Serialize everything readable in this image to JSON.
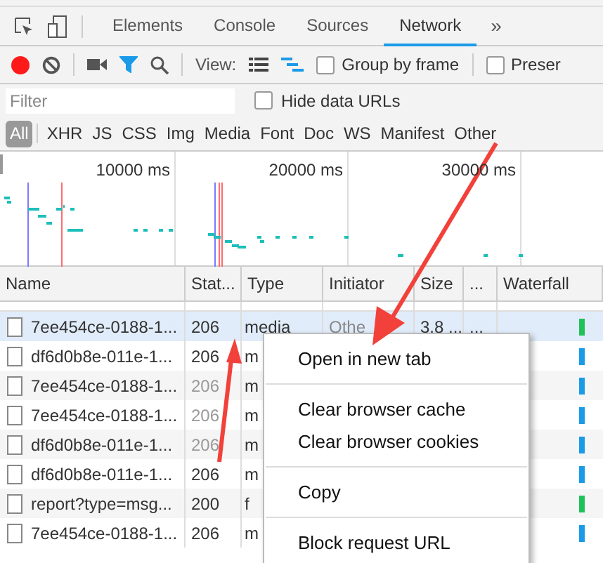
{
  "tabs": [
    {
      "label": "Elements",
      "selected": false
    },
    {
      "label": "Console",
      "selected": false
    },
    {
      "label": "Sources",
      "selected": false
    },
    {
      "label": "Network",
      "selected": true
    }
  ],
  "more_tabs": "»",
  "toolbar": {
    "recording": true,
    "filter_on": true,
    "view_label": "View:",
    "group_by_frame": {
      "label": "Group by frame",
      "checked": false
    },
    "preserve": {
      "label": "Preser",
      "checked": false
    }
  },
  "filter": {
    "placeholder": "Filter",
    "hide_data_urls": {
      "label": "Hide data URLs",
      "checked": false
    }
  },
  "types": [
    {
      "label": "All",
      "selected": true
    },
    {
      "label": "XHR",
      "selected": false
    },
    {
      "label": "JS",
      "selected": false
    },
    {
      "label": "CSS",
      "selected": false
    },
    {
      "label": "Img",
      "selected": false
    },
    {
      "label": "Media",
      "selected": false
    },
    {
      "label": "Font",
      "selected": false
    },
    {
      "label": "Doc",
      "selected": false
    },
    {
      "label": "WS",
      "selected": false
    },
    {
      "label": "Manifest",
      "selected": false
    },
    {
      "label": "Other",
      "selected": false
    }
  ],
  "overview": {
    "ticks": [
      "10000 ms",
      "20000 ms",
      "30000 ms"
    ]
  },
  "table": {
    "columns": [
      "Name",
      "Stat...",
      "Type",
      "Initiator",
      "Size",
      "...",
      "Waterfall"
    ],
    "rows": [
      {
        "name": "7ee454ce-0188-1...",
        "status": "206",
        "dimmed": false,
        "type": "media",
        "initiator": "Othe",
        "size": "3.8 ...",
        "extra": "...",
        "selected": true,
        "color": "#1fc15a"
      },
      {
        "name": "df6d0b8e-011e-1...",
        "status": "206",
        "dimmed": false,
        "type": "m",
        "selected": false,
        "color": "#1a9be8"
      },
      {
        "name": "7ee454ce-0188-1...",
        "status": "206",
        "dimmed": true,
        "type": "m",
        "selected": false,
        "color": "#1a9be8"
      },
      {
        "name": "7ee454ce-0188-1...",
        "status": "206",
        "dimmed": true,
        "type": "m",
        "selected": false,
        "color": "#1a9be8"
      },
      {
        "name": "df6d0b8e-011e-1...",
        "status": "206",
        "dimmed": true,
        "type": "m",
        "selected": false,
        "color": "#1a9be8"
      },
      {
        "name": "df6d0b8e-011e-1...",
        "status": "206",
        "dimmed": false,
        "type": "m",
        "selected": false,
        "color": "#1a9be8"
      },
      {
        "name": "report?type=msg...",
        "status": "200",
        "dimmed": false,
        "type": "f",
        "selected": false,
        "color": "#1fc15a"
      },
      {
        "name": "7ee454ce-0188-1...",
        "status": "206",
        "dimmed": false,
        "type": "m",
        "selected": false,
        "color": "#1a9be8"
      }
    ]
  },
  "context_menu": [
    {
      "kind": "item",
      "label": "Open in new tab"
    },
    {
      "kind": "separator"
    },
    {
      "kind": "item",
      "label": "Clear browser cache"
    },
    {
      "kind": "item",
      "label": "Clear browser cookies"
    },
    {
      "kind": "separator"
    },
    {
      "kind": "item",
      "label": "Copy"
    },
    {
      "kind": "separator"
    },
    {
      "kind": "item",
      "label": "Block request URL"
    }
  ]
}
